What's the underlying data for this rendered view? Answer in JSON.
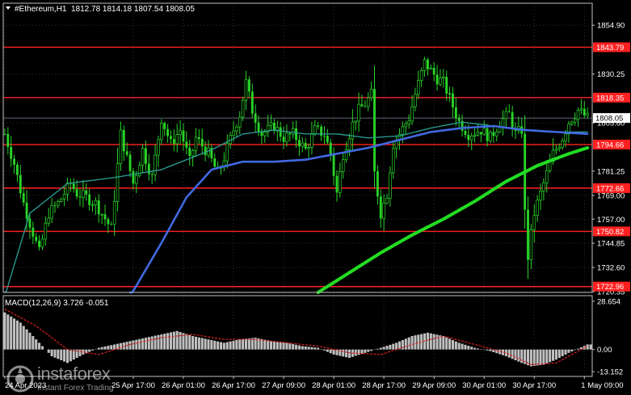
{
  "header": {
    "symbol": "#Ethereum,H1",
    "ohlc": "1812.78 1814.18 1807.54 1808.05"
  },
  "price_panel": {
    "ylim": [
      1720.0,
      1866.0
    ],
    "ticks": [
      1854.9,
      1830.25,
      1805.6,
      1781.25,
      1769.0,
      1757.0,
      1744.85,
      1732.6,
      1720.35
    ],
    "current_price": {
      "value": 1808.05,
      "label": "1808.05"
    },
    "levels": [
      {
        "value": 1843.79,
        "label": "1843.79"
      },
      {
        "value": 1818.35,
        "label": "1818.35"
      },
      {
        "value": 1794.66,
        "label": "1794.66"
      },
      {
        "value": 1772.66,
        "label": "1772.66"
      },
      {
        "value": 1750.82,
        "label": "1750.82"
      },
      {
        "value": 1722.96,
        "label": "1722.96"
      }
    ]
  },
  "macd_panel": {
    "label": "MACD(12,26,9) 3.726 -0.051",
    "ylim": [
      -16.0,
      32.0
    ],
    "ticks": [
      28.654,
      0.0,
      -13.152
    ],
    "tick_labels": [
      "28.654",
      "0.00",
      "-13.152"
    ]
  },
  "x_axis": {
    "labels": [
      "24 Apr 2023",
      "25 Apr 17:00",
      "26 Apr 01:00",
      "26 Apr 17:00",
      "27 Apr 09:00",
      "28 Apr 01:00",
      "28 Apr 17:00",
      "29 Apr 09:00",
      "30 Apr 01:00",
      "30 Apr 17:00",
      "1 May 09:00"
    ],
    "label_bars": [
      0,
      41,
      57,
      73,
      89,
      105,
      121,
      137,
      153,
      169,
      185
    ]
  },
  "chart_data": {
    "type": "candlestick",
    "symbol": "#Ethereum",
    "timeframe": "H1",
    "ylim": [
      1720.0,
      1866.0
    ],
    "close_anchors": {
      "bars": [
        0,
        3,
        6,
        9,
        11,
        14,
        17,
        21,
        23,
        26,
        29,
        34,
        37,
        41,
        44,
        47,
        50,
        53,
        56,
        59,
        61,
        65,
        68,
        70,
        73,
        75,
        77,
        79,
        82,
        86,
        89,
        92,
        96,
        99,
        102,
        104,
        106,
        108,
        111,
        113,
        115,
        117,
        118,
        120,
        122,
        124,
        126,
        129,
        131,
        134,
        136,
        138,
        140,
        142,
        145,
        148,
        152,
        155,
        158,
        161,
        163,
        165,
        166,
        167,
        169,
        172,
        175,
        178,
        180,
        183,
        186
      ],
      "closes": [
        1800,
        1785,
        1765,
        1750,
        1740,
        1760,
        1765,
        1775,
        1770,
        1768,
        1765,
        1752,
        1800,
        1775,
        1792,
        1778,
        1808,
        1795,
        1802,
        1786,
        1798,
        1790,
        1780,
        1788,
        1802,
        1810,
        1826,
        1812,
        1800,
        1804,
        1798,
        1800,
        1792,
        1802,
        1800,
        1790,
        1770,
        1790,
        1805,
        1812,
        1815,
        1820,
        1780,
        1760,
        1770,
        1795,
        1800,
        1808,
        1820,
        1836,
        1832,
        1828,
        1826,
        1818,
        1806,
        1800,
        1802,
        1798,
        1806,
        1810,
        1800,
        1802,
        1760,
        1738,
        1760,
        1775,
        1790,
        1798,
        1806,
        1812,
        1808
      ]
    },
    "moving_averages": [
      {
        "color": "#2aa198",
        "bars": [
          0,
          8,
          20,
          35,
          50,
          58,
          66,
          76,
          86,
          96,
          106,
          116,
          126,
          136,
          146,
          156,
          166,
          176,
          186
        ],
        "values": [
          1718,
          1760,
          1775,
          1778,
          1782,
          1787,
          1792,
          1800,
          1802,
          1800,
          1800,
          1798,
          1799,
          1803,
          1806,
          1804,
          1802,
          1801,
          1801
        ]
      },
      {
        "color": "#4169e1",
        "bars": [
          40,
          50,
          58,
          66,
          76,
          86,
          96,
          106,
          116,
          126,
          136,
          146,
          156,
          166,
          176,
          186
        ],
        "values": [
          1718,
          1745,
          1768,
          1782,
          1786,
          1786,
          1787,
          1790,
          1793,
          1797,
          1801,
          1803,
          1804,
          1802,
          1801,
          1800
        ]
      },
      {
        "color": "#22dd22",
        "bars": [
          100,
          110,
          120,
          130,
          140,
          150,
          160,
          170,
          180,
          186
        ],
        "values": [
          1720,
          1730,
          1740,
          1749,
          1757,
          1766,
          1776,
          1784,
          1790,
          1793
        ]
      }
    ],
    "macd": {
      "signal_color": "#d82020",
      "hist_bars": [
        0,
        5,
        10,
        15,
        20,
        25,
        30,
        35,
        40,
        45,
        50,
        55,
        60,
        65,
        70,
        75,
        80,
        85,
        90,
        95,
        100,
        105,
        110,
        115,
        120,
        125,
        130,
        135,
        140,
        145,
        150,
        155,
        160,
        165,
        168,
        172,
        176,
        180,
        186
      ],
      "hist": [
        22,
        16,
        6,
        -4,
        -8,
        -3,
        1,
        3,
        5,
        7,
        9,
        11,
        8,
        6,
        4,
        6,
        7,
        5,
        4,
        2,
        1,
        -3,
        -5,
        -2,
        1,
        4,
        8,
        10,
        8,
        4,
        1,
        -1,
        -4,
        -8,
        -10,
        -9,
        -6,
        -2,
        3
      ],
      "signal_bars": [
        0,
        10,
        20,
        30,
        40,
        50,
        60,
        70,
        80,
        90,
        100,
        110,
        120,
        130,
        140,
        150,
        160,
        168,
        176,
        186
      ],
      "signal": [
        24,
        14,
        0,
        -3,
        3,
        7,
        9,
        6,
        6,
        4,
        2,
        -2,
        -3,
        3,
        8,
        3,
        -2,
        -9,
        -8,
        2
      ]
    }
  },
  "watermark": {
    "brand": "instaforex",
    "tagline": "Instant Forex Trading"
  }
}
